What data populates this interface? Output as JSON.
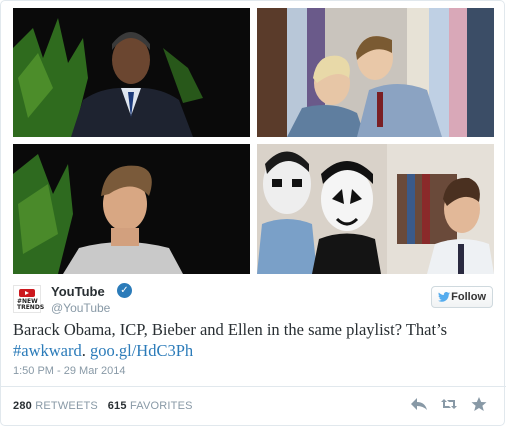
{
  "account": {
    "display_name": "YouTube",
    "handle": "@YouTube",
    "avatar_text": "#NEW\nTRENDS",
    "verified_icon": "check-icon",
    "follow_label": "Follow"
  },
  "tweet": {
    "text_before": "Barack Obama, ICP, Bieber and Ellen in the same playlist? That’s",
    "hashtag": "#awkward",
    "space": ". ",
    "link": "goo.gl/HdC3Ph",
    "timestamp": "1:50 PM - 29 Mar 2014"
  },
  "stats": {
    "retweets_count": "280",
    "retweets_label": "RETWEETS",
    "favorites_count": "615",
    "favorites_label": "FAVORITES"
  },
  "actions": [
    "reply-icon",
    "retweet-icon",
    "favorite-icon"
  ],
  "colors": {
    "link": "#2b7bb9",
    "muted": "#8899a6",
    "text": "#292f33",
    "verified": "#2b7bb9"
  }
}
